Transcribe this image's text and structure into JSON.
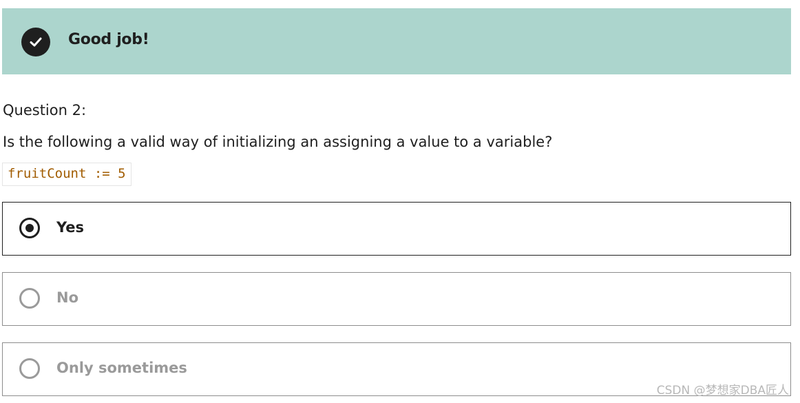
{
  "feedback": {
    "message": "Good job!",
    "icon": "check-icon",
    "background_color": "#acd5cd"
  },
  "question": {
    "number_label": "Question 2:",
    "prompt": "Is the following a valid way of initializing an assigning a value to a variable?",
    "code": "fruitCount := 5"
  },
  "options": [
    {
      "label": "Yes",
      "selected": true
    },
    {
      "label": "No",
      "selected": false
    },
    {
      "label": "Only sometimes",
      "selected": false
    }
  ],
  "watermark": "CSDN @梦想家DBA匠人"
}
